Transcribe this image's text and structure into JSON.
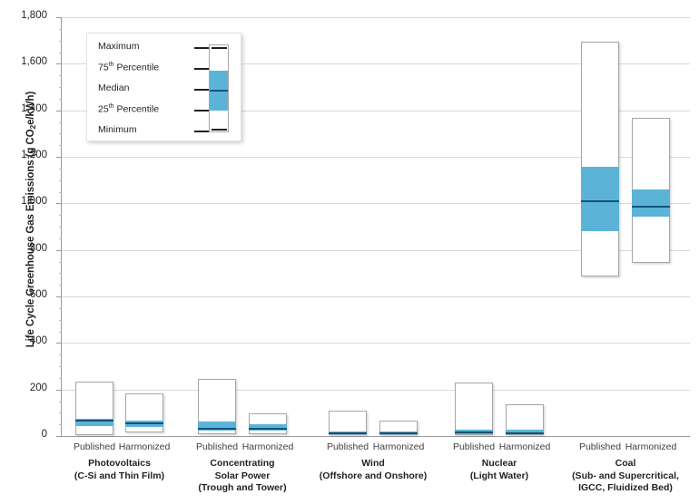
{
  "chart_data": {
    "type": "box",
    "title": "",
    "xlabel": "",
    "ylabel": "Life Cycle Greenhouse Gas Emissions (g CO2e/kWh)",
    "ylabel_prefix": "Life Cycle Greenhouse Gas Emissions (g CO",
    "ylabel_sub": "2",
    "ylabel_suffix": "e/kWh)",
    "ylim": [
      0,
      1800
    ],
    "ytick_values": [
      0,
      200,
      400,
      600,
      800,
      1000,
      1200,
      1400,
      1600,
      1800
    ],
    "ytick_labels": [
      "0",
      "200",
      "400",
      "600",
      "800",
      "1,000",
      "1,200",
      "1,400",
      "1,600",
      "1,800"
    ],
    "yminor_step": 50,
    "grid": true,
    "legend_position": "upper-left",
    "accent_color": "#5bb4d8",
    "median_color": "#12537a",
    "box_border_color": "#a6a6a6",
    "grid_color": "#d9d9d9",
    "axis_color": "#9a9a9a",
    "subcategories": [
      "Published",
      "Harmonized"
    ],
    "groups": [
      {
        "name": "Photovoltaics",
        "name_line2": "(C-Si and Thin Film)",
        "boxes": [
          {
            "label": "Published",
            "min": 4,
            "q1": 43,
            "median": 66,
            "q3": 75,
            "max": 234
          },
          {
            "label": "Harmonized",
            "min": 14,
            "q1": 39,
            "median": 55,
            "q3": 66,
            "max": 183
          }
        ]
      },
      {
        "name": "Concentrating",
        "name_line2": "Solar Power",
        "name_line3": "(Trough and Tower)",
        "boxes": [
          {
            "label": "Published",
            "min": 7,
            "q1": 23,
            "median": 31,
            "q3": 62,
            "max": 245
          },
          {
            "label": "Harmonized",
            "min": 8,
            "q1": 25,
            "median": 33,
            "q3": 51,
            "max": 97
          }
        ]
      },
      {
        "name": "Wind",
        "name_line2": "(Offshore and Onshore)",
        "boxes": [
          {
            "label": "Published",
            "min": 2,
            "q1": 8,
            "median": 12,
            "q3": 20,
            "max": 109
          },
          {
            "label": "Harmonized",
            "min": 4,
            "q1": 8,
            "median": 12,
            "q3": 20,
            "max": 66
          }
        ]
      },
      {
        "name": "Nuclear",
        "name_line2": "(Light Water)",
        "boxes": [
          {
            "label": "Published",
            "min": 2,
            "q1": 9,
            "median": 16,
            "q3": 28,
            "max": 230
          },
          {
            "label": "Harmonized",
            "min": 4,
            "q1": 9,
            "median": 13,
            "q3": 27,
            "max": 136
          }
        ]
      },
      {
        "name": "Coal",
        "name_line2": "(Sub- and Supercritical,",
        "name_line3": "IGCC, Fluidized Bed)",
        "boxes": [
          {
            "label": "Published",
            "min": 686,
            "q1": 880,
            "median": 1009,
            "q3": 1157,
            "max": 1695
          },
          {
            "label": "Harmonized",
            "min": 744,
            "q1": 942,
            "median": 985,
            "q3": 1059,
            "max": 1367
          }
        ]
      }
    ]
  },
  "legend": {
    "title": "",
    "entries": [
      {
        "label": "Maximum",
        "sup": ""
      },
      {
        "label": "75 Percentile",
        "sup": "th",
        "prefix": "75",
        "suffix": " Percentile"
      },
      {
        "label": "Median",
        "sup": ""
      },
      {
        "label": "25 Percentile",
        "sup": "th",
        "prefix": "25",
        "suffix": " Percentile"
      },
      {
        "label": "Minimum",
        "sup": ""
      }
    ]
  }
}
